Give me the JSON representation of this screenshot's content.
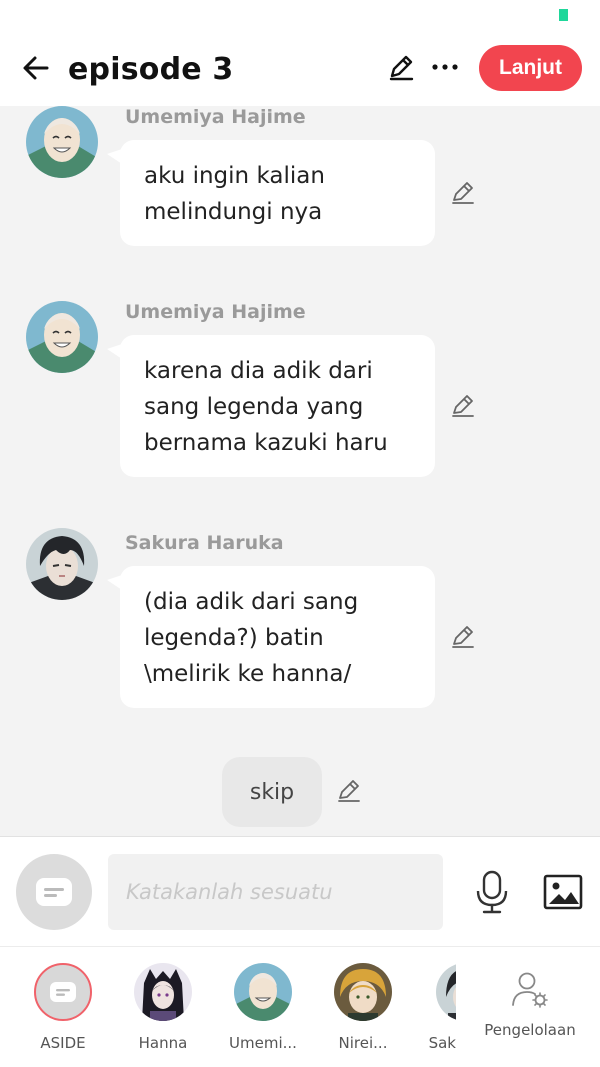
{
  "header": {
    "title": "episode 3",
    "next_label": "Lanjut"
  },
  "colors": {
    "accent": "#f2454f",
    "status_indicator": "#1fd79a"
  },
  "messages": [
    {
      "sender": "Umemiya Hajime",
      "text": "aku ingin kalian melindungi nya"
    },
    {
      "sender": "Umemiya Hajime",
      "text": "karena dia adik dari sang legenda yang bernama kazuki haru"
    },
    {
      "sender": "Sakura Haruka",
      "text": "(dia adik dari sang legenda?) batin \\melirik ke hanna/"
    }
  ],
  "narration": {
    "text": "skip"
  },
  "composer": {
    "placeholder": "Katakanlah sesuatu"
  },
  "characters": [
    {
      "label": "ASIDE"
    },
    {
      "label": "Hanna"
    },
    {
      "label": "Umemi..."
    },
    {
      "label": "Nirei..."
    },
    {
      "label": "Sak"
    }
  ],
  "manage_label": "Pengelolaan"
}
